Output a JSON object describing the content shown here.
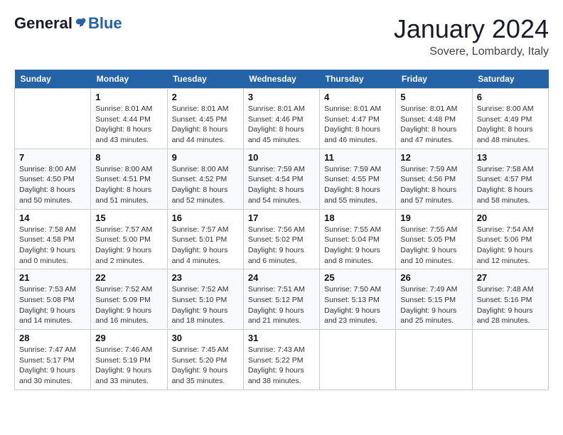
{
  "header": {
    "logo": {
      "general": "General",
      "blue": "Blue"
    },
    "title": "January 2024",
    "location": "Sovere, Lombardy, Italy"
  },
  "weekdays": [
    "Sunday",
    "Monday",
    "Tuesday",
    "Wednesday",
    "Thursday",
    "Friday",
    "Saturday"
  ],
  "weeks": [
    [
      {
        "day": "",
        "info": ""
      },
      {
        "day": "1",
        "info": "Sunrise: 8:01 AM\nSunset: 4:44 PM\nDaylight: 8 hours\nand 43 minutes."
      },
      {
        "day": "2",
        "info": "Sunrise: 8:01 AM\nSunset: 4:45 PM\nDaylight: 8 hours\nand 44 minutes."
      },
      {
        "day": "3",
        "info": "Sunrise: 8:01 AM\nSunset: 4:46 PM\nDaylight: 8 hours\nand 45 minutes."
      },
      {
        "day": "4",
        "info": "Sunrise: 8:01 AM\nSunset: 4:47 PM\nDaylight: 8 hours\nand 46 minutes."
      },
      {
        "day": "5",
        "info": "Sunrise: 8:01 AM\nSunset: 4:48 PM\nDaylight: 8 hours\nand 47 minutes."
      },
      {
        "day": "6",
        "info": "Sunrise: 8:00 AM\nSunset: 4:49 PM\nDaylight: 8 hours\nand 48 minutes."
      }
    ],
    [
      {
        "day": "7",
        "info": "Sunrise: 8:00 AM\nSunset: 4:50 PM\nDaylight: 8 hours\nand 50 minutes."
      },
      {
        "day": "8",
        "info": "Sunrise: 8:00 AM\nSunset: 4:51 PM\nDaylight: 8 hours\nand 51 minutes."
      },
      {
        "day": "9",
        "info": "Sunrise: 8:00 AM\nSunset: 4:52 PM\nDaylight: 8 hours\nand 52 minutes."
      },
      {
        "day": "10",
        "info": "Sunrise: 7:59 AM\nSunset: 4:54 PM\nDaylight: 8 hours\nand 54 minutes."
      },
      {
        "day": "11",
        "info": "Sunrise: 7:59 AM\nSunset: 4:55 PM\nDaylight: 8 hours\nand 55 minutes."
      },
      {
        "day": "12",
        "info": "Sunrise: 7:59 AM\nSunset: 4:56 PM\nDaylight: 8 hours\nand 57 minutes."
      },
      {
        "day": "13",
        "info": "Sunrise: 7:58 AM\nSunset: 4:57 PM\nDaylight: 8 hours\nand 58 minutes."
      }
    ],
    [
      {
        "day": "14",
        "info": "Sunrise: 7:58 AM\nSunset: 4:58 PM\nDaylight: 9 hours\nand 0 minutes."
      },
      {
        "day": "15",
        "info": "Sunrise: 7:57 AM\nSunset: 5:00 PM\nDaylight: 9 hours\nand 2 minutes."
      },
      {
        "day": "16",
        "info": "Sunrise: 7:57 AM\nSunset: 5:01 PM\nDaylight: 9 hours\nand 4 minutes."
      },
      {
        "day": "17",
        "info": "Sunrise: 7:56 AM\nSunset: 5:02 PM\nDaylight: 9 hours\nand 6 minutes."
      },
      {
        "day": "18",
        "info": "Sunrise: 7:55 AM\nSunset: 5:04 PM\nDaylight: 9 hours\nand 8 minutes."
      },
      {
        "day": "19",
        "info": "Sunrise: 7:55 AM\nSunset: 5:05 PM\nDaylight: 9 hours\nand 10 minutes."
      },
      {
        "day": "20",
        "info": "Sunrise: 7:54 AM\nSunset: 5:06 PM\nDaylight: 9 hours\nand 12 minutes."
      }
    ],
    [
      {
        "day": "21",
        "info": "Sunrise: 7:53 AM\nSunset: 5:08 PM\nDaylight: 9 hours\nand 14 minutes."
      },
      {
        "day": "22",
        "info": "Sunrise: 7:52 AM\nSunset: 5:09 PM\nDaylight: 9 hours\nand 16 minutes."
      },
      {
        "day": "23",
        "info": "Sunrise: 7:52 AM\nSunset: 5:10 PM\nDaylight: 9 hours\nand 18 minutes."
      },
      {
        "day": "24",
        "info": "Sunrise: 7:51 AM\nSunset: 5:12 PM\nDaylight: 9 hours\nand 21 minutes."
      },
      {
        "day": "25",
        "info": "Sunrise: 7:50 AM\nSunset: 5:13 PM\nDaylight: 9 hours\nand 23 minutes."
      },
      {
        "day": "26",
        "info": "Sunrise: 7:49 AM\nSunset: 5:15 PM\nDaylight: 9 hours\nand 25 minutes."
      },
      {
        "day": "27",
        "info": "Sunrise: 7:48 AM\nSunset: 5:16 PM\nDaylight: 9 hours\nand 28 minutes."
      }
    ],
    [
      {
        "day": "28",
        "info": "Sunrise: 7:47 AM\nSunset: 5:17 PM\nDaylight: 9 hours\nand 30 minutes."
      },
      {
        "day": "29",
        "info": "Sunrise: 7:46 AM\nSunset: 5:19 PM\nDaylight: 9 hours\nand 33 minutes."
      },
      {
        "day": "30",
        "info": "Sunrise: 7:45 AM\nSunset: 5:20 PM\nDaylight: 9 hours\nand 35 minutes."
      },
      {
        "day": "31",
        "info": "Sunrise: 7:43 AM\nSunset: 5:22 PM\nDaylight: 9 hours\nand 38 minutes."
      },
      {
        "day": "",
        "info": ""
      },
      {
        "day": "",
        "info": ""
      },
      {
        "day": "",
        "info": ""
      }
    ]
  ]
}
